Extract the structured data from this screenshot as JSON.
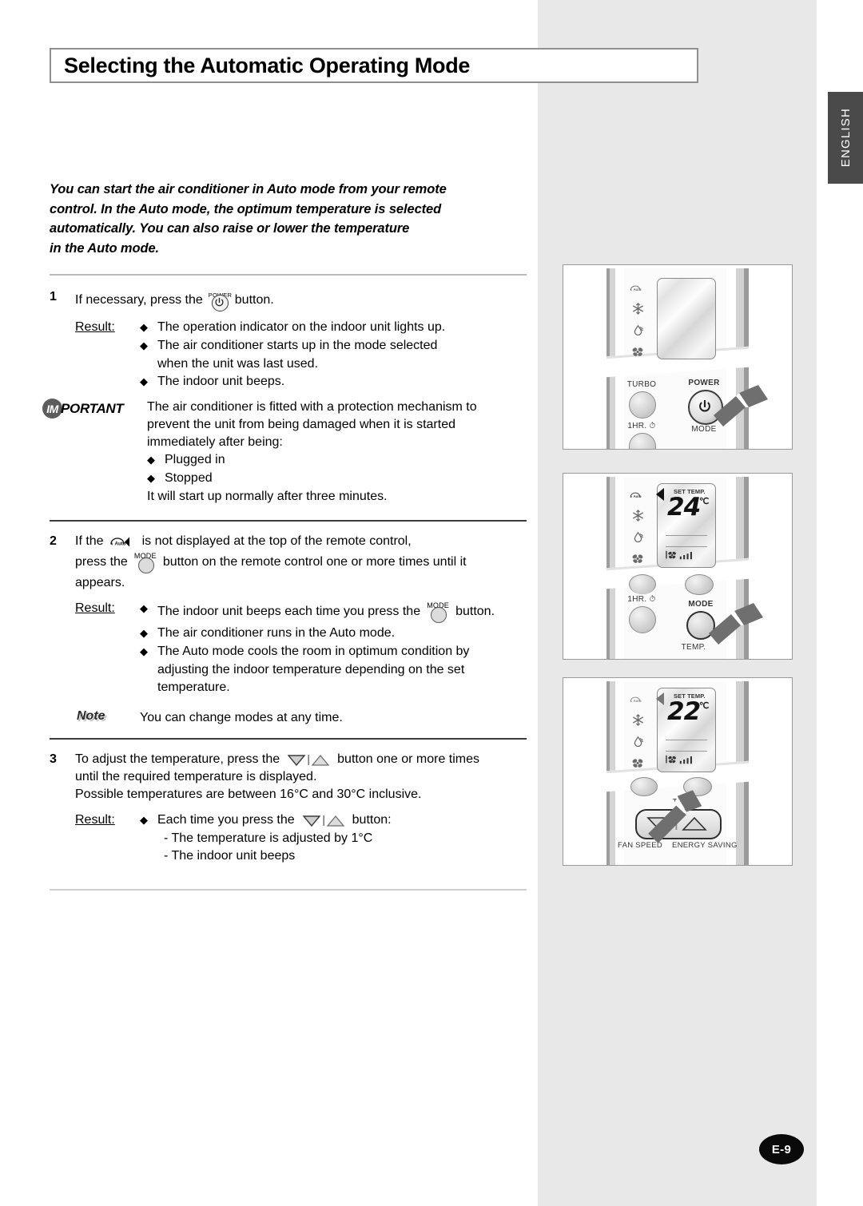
{
  "page": {
    "title": "Selecting the Automatic Operating Mode",
    "language_tab": "ENGLISH",
    "page_number": "E-9"
  },
  "intro": {
    "line1": "You can start the air conditioner in Auto mode from your remote",
    "line2": "control. In the Auto mode, the optimum temperature is selected",
    "line3": "automatically. You can also raise or lower the temperature",
    "line4": "in the Auto mode."
  },
  "steps": [
    {
      "number": "1",
      "text_before": "If necessary, press the",
      "icon": "power-button-icon",
      "icon_caption": "POWER",
      "text_after": "button.",
      "result_label": "Result:",
      "results": [
        "The operation indicator on the indoor unit lights up.",
        "The air conditioner starts up in the mode selected",
        "when the unit was last used.",
        "The indoor unit beeps."
      ]
    },
    {
      "number": "2",
      "text_before": "If the",
      "icon": "auto-mode-icon",
      "text_mid1": "is not displayed at the top of the remote control,",
      "text_mid2": "press the",
      "icon2": "mode-button-icon",
      "icon2_caption": "MODE",
      "text_mid3": "button on the remote control one or more times until it",
      "text_after": "appears.",
      "result_label": "Result:",
      "results_part1": "The indoor unit beeps each time you press the",
      "results_part2": "button.",
      "results": [
        "The air conditioner runs in the Auto mode.",
        "The Auto mode cools the room in optimum condition by",
        "adjusting the indoor temperature depending on the set",
        "temperature."
      ]
    },
    {
      "number": "3",
      "text_before": "To adjust the temperature, press the",
      "icon": "temp-up-down-icon",
      "text_after": "button one or more times",
      "line2": "until the required temperature is displayed.",
      "line3": "Possible temperatures are between 16°C and 30°C inclusive.",
      "result_label": "Result:",
      "result_intro": "Each time you press the",
      "result_intro_after": "button:",
      "sub_results": [
        "- The temperature is adjusted by 1°C",
        "- The indoor unit beeps"
      ]
    }
  ],
  "important": {
    "badge": "IM",
    "label": "PORTANT",
    "lines": [
      "The air conditioner is fitted with a protection mechanism to",
      "prevent the unit from being damaged when it is started",
      "immediately after being:"
    ],
    "bullets": [
      "Plugged in",
      "Stopped"
    ],
    "closing": "It will start up normally after three minutes."
  },
  "note": {
    "label": "Note",
    "text": "You can change modes at any time."
  },
  "illustrations": [
    {
      "id": "panel-power",
      "mode_icons": [
        "auto-icon",
        "snowflake-icon",
        "dry-drop-icon",
        "fan-icon"
      ],
      "buttons": [
        "TURBO",
        "POWER",
        "1HR.",
        "MODE"
      ],
      "pressed_button": "POWER",
      "display": ""
    },
    {
      "id": "panel-mode",
      "mode_icons": [
        "auto-icon",
        "snowflake-icon",
        "dry-drop-icon",
        "fan-icon"
      ],
      "display_caption": "SET TEMP.",
      "display_value": "24",
      "display_unit": "℃",
      "buttons": [
        "1HR.",
        "MODE",
        "TEMP."
      ],
      "pressed_button": "MODE",
      "indicator": "auto-pointer"
    },
    {
      "id": "panel-temp",
      "mode_icons": [
        "auto-icon",
        "snowflake-icon",
        "dry-drop-icon",
        "fan-icon"
      ],
      "display_caption": "SET TEMP.",
      "display_value": "22",
      "display_unit": "℃",
      "buttons": [
        "TEMP.",
        "FAN SPEED",
        "ENERGY SAVING"
      ],
      "pressed_button": "TEMP. down/up",
      "indicator": "auto-pointer"
    }
  ],
  "colors": {
    "page_band": "#e8e8e8",
    "tab_bg": "#4a4a4a",
    "title_border": "#8f8f8f",
    "badge_bg": "#0a0a0a"
  }
}
